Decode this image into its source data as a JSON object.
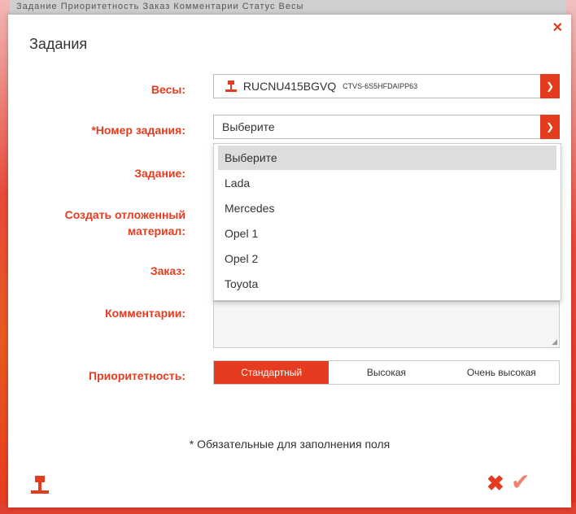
{
  "background": {
    "top_text": "Задание  Приоритетность  Заказ  Комментарии  Статус  Весы"
  },
  "dialog": {
    "title": "Задания",
    "close_glyph": "✕"
  },
  "form": {
    "scale": {
      "label": "Весы:",
      "code": "RUCNU415BGVQ",
      "sub": "CTVS-6S5HFDAIPP63"
    },
    "task_number": {
      "label": "*Номер задания:",
      "value": "Выберите"
    },
    "task": {
      "label": "Задание:"
    },
    "deferred": {
      "label_line1": "Создать отложенный",
      "label_line2": "материал:"
    },
    "order": {
      "label": "Заказ:"
    },
    "comments": {
      "label": "Комментарии:",
      "value": ""
    },
    "priority": {
      "label": "Приоритетность:",
      "options": [
        "Стандартный",
        "Высокая",
        "Очень высокая"
      ],
      "selected": "Стандартный"
    }
  },
  "dropdown": {
    "options": [
      "Выберите",
      "Lada",
      "Mercedes",
      "Opel 1",
      "Opel 2",
      "Toyota"
    ],
    "highlighted": "Выберите"
  },
  "required_note": "* Обязательные для заполнения поля",
  "footer": {
    "cancel_glyph": "✖",
    "confirm_glyph": "✔"
  },
  "colors": {
    "accent": "#e53b1e",
    "confirm": "#f08070"
  }
}
